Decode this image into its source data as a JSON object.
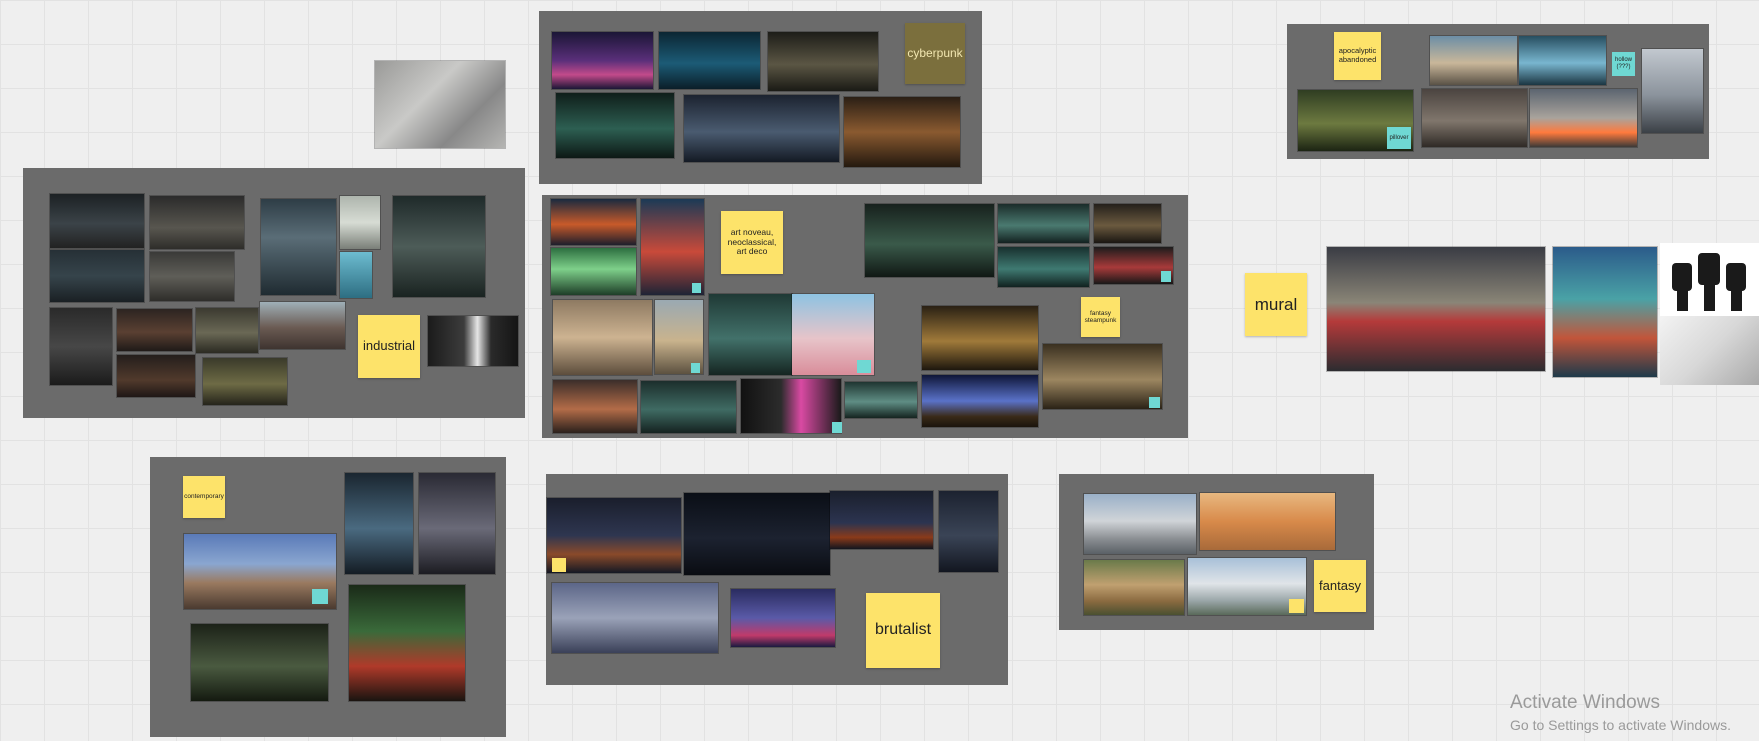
{
  "boards": {
    "industrial": {
      "label": "industrial"
    },
    "cyberpunk": {
      "label": "cyberpunk"
    },
    "apocalyptic": {
      "label": "apocalyptic\nabandoned",
      "tag_pillover": "pillover",
      "tag_hollow": "hollow\n(???)"
    },
    "artnouveau": {
      "label": "art noveau,\nneoclassical,\nart deco",
      "fantasy_steampunk": "fantasy\nsteampunk"
    },
    "mural": {
      "label": "mural"
    },
    "contemporary": {
      "label": "contemporary"
    },
    "brutalist": {
      "label": "brutalist"
    },
    "fantasy": {
      "label": "fantasy"
    }
  },
  "watermark": {
    "title": "Activate Windows",
    "subtitle": "Go to Settings to activate Windows."
  },
  "colors": {
    "frame": "#6b6b6b",
    "sticky": "#fde36a",
    "teal_note": "#6fd8d3",
    "canvas": "#efefef"
  }
}
